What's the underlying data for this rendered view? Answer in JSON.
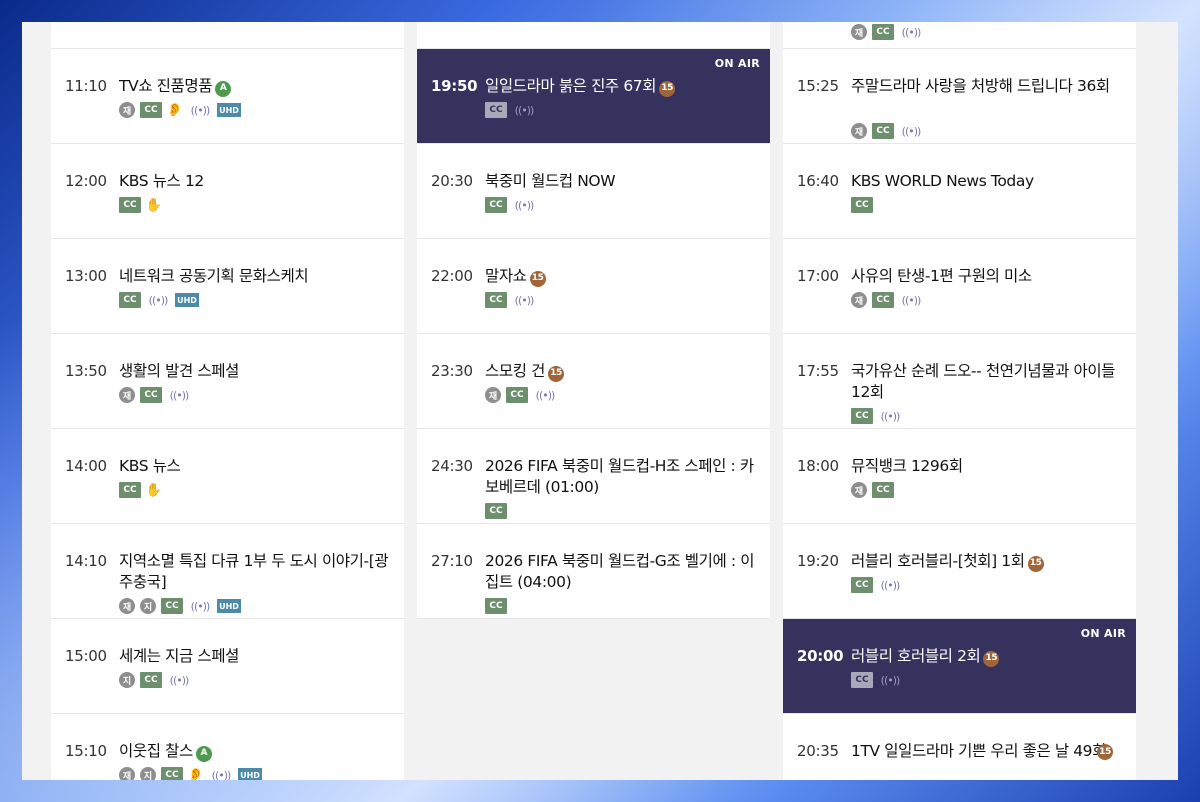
{
  "labels": {
    "on_air": "ON AIR",
    "re": "재",
    "ji": "지",
    "cc": "CC",
    "uhd": "UHD",
    "live": "((•))",
    "ear": "👂",
    "hand": "✋",
    "badge_a": "A",
    "badge_15": "15"
  },
  "columns": [
    {
      "top_icons": [],
      "programs": [
        {
          "time": "11:10",
          "title": "TV쇼 진품명품",
          "badge": "A",
          "icons": [
            "re",
            "cc",
            "ear",
            "live",
            "uhd"
          ],
          "on_air": false
        },
        {
          "time": "12:00",
          "title": "KBS 뉴스 12",
          "badge": "",
          "icons": [
            "cc",
            "hand"
          ],
          "on_air": false
        },
        {
          "time": "13:00",
          "title": "네트워크 공동기획 문화스케치",
          "badge": "",
          "icons": [
            "cc",
            "live",
            "uhd"
          ],
          "on_air": false
        },
        {
          "time": "13:50",
          "title": "생활의 발견 스페셜",
          "badge": "",
          "icons": [
            "re",
            "cc",
            "live"
          ],
          "on_air": false
        },
        {
          "time": "14:00",
          "title": "KBS 뉴스",
          "badge": "",
          "icons": [
            "cc",
            "hand"
          ],
          "on_air": false
        },
        {
          "time": "14:10",
          "title": "지역소멸 특집 다큐 1부 두 도시 이야기-[광주충국]",
          "badge": "",
          "icons": [
            "re",
            "ji",
            "cc",
            "live",
            "uhd"
          ],
          "on_air": false,
          "two_line": true
        },
        {
          "time": "15:00",
          "title": "세계는 지금 스페셜",
          "badge": "",
          "icons": [
            "ji",
            "cc",
            "live"
          ],
          "on_air": false
        },
        {
          "time": "15:10",
          "title": "이웃집 찰스",
          "badge": "A",
          "icons": [
            "re",
            "ji",
            "cc",
            "ear",
            "live",
            "uhd"
          ],
          "on_air": false
        }
      ]
    },
    {
      "top_icons": [],
      "programs": [
        {
          "time": "19:50",
          "title": "일일드라마 붉은 진주 67회",
          "badge": "15",
          "icons": [
            "cc",
            "live"
          ],
          "on_air": true
        },
        {
          "time": "20:30",
          "title": "북중미 월드컵 NOW",
          "badge": "",
          "icons": [
            "cc",
            "live"
          ],
          "on_air": false
        },
        {
          "time": "22:00",
          "title": "말자쇼",
          "badge": "15",
          "icons": [
            "cc",
            "live"
          ],
          "on_air": false
        },
        {
          "time": "23:30",
          "title": "스모킹 건",
          "badge": "15",
          "icons": [
            "re",
            "cc",
            "live"
          ],
          "on_air": false
        },
        {
          "time": "24:30",
          "title": "2026 FIFA 북중미 월드컵-H조 스페인 : 카보베르데 (01:00)",
          "badge": "",
          "icons": [
            "cc"
          ],
          "on_air": false,
          "two_line": true
        },
        {
          "time": "27:10",
          "title": "2026 FIFA 북중미 월드컵-G조 벨기에 : 이집트 (04:00)",
          "badge": "",
          "icons": [
            "cc"
          ],
          "on_air": false,
          "two_line": true
        }
      ]
    },
    {
      "top_icons": [
        "re",
        "cc",
        "live"
      ],
      "programs": [
        {
          "time": "15:25",
          "title": "주말드라마 사랑을 처방해 드립니다 36회",
          "badge": "",
          "icons": [
            "re",
            "cc",
            "live"
          ],
          "on_air": false,
          "two_line": true
        },
        {
          "time": "16:40",
          "title": "KBS WORLD News Today",
          "badge": "",
          "icons": [
            "cc"
          ],
          "on_air": false
        },
        {
          "time": "17:00",
          "title": "사유의 탄생-1편 구원의 미소",
          "badge": "",
          "icons": [
            "re",
            "cc",
            "live"
          ],
          "on_air": false
        },
        {
          "time": "17:55",
          "title": "국가유산 순례 드오-- 천연기념물과 아이들 12회",
          "badge": "",
          "icons": [
            "cc",
            "live"
          ],
          "on_air": false,
          "two_line": true
        },
        {
          "time": "18:00",
          "title": "뮤직뱅크 1296회",
          "badge": "",
          "icons": [
            "re",
            "cc"
          ],
          "on_air": false
        },
        {
          "time": "19:20",
          "title": "러블리 호러블리-[첫회] 1회",
          "badge": "15",
          "icons": [
            "cc",
            "live"
          ],
          "on_air": false
        },
        {
          "time": "20:00",
          "title": "러블리 호러블리 2회",
          "badge": "15",
          "icons": [
            "cc",
            "live"
          ],
          "on_air": true
        },
        {
          "time": "20:35",
          "title": "1TV 일일드라마 기쁜 우리 좋은 날 49회",
          "badge": "15",
          "icons": [],
          "on_air": false,
          "two_line": true,
          "badge_right": true
        }
      ]
    }
  ]
}
